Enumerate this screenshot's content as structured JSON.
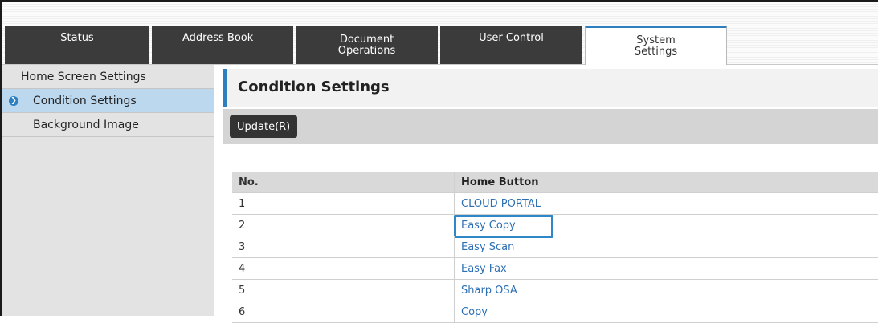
{
  "tabs": [
    {
      "label": "Status"
    },
    {
      "label": "Address Book"
    },
    {
      "label": "Document\nOperations"
    },
    {
      "label": "User Control"
    },
    {
      "label": "System\nSettings"
    }
  ],
  "sidebar": {
    "items": [
      {
        "label": "Home Screen Settings"
      },
      {
        "label": "Condition Settings"
      },
      {
        "label": "Background Image"
      }
    ],
    "selected_index": 1
  },
  "main": {
    "title": "Condition Settings",
    "update_label": "Update(R)"
  },
  "table": {
    "headers": [
      "No.",
      "Home Button"
    ],
    "rows": [
      [
        "1",
        "CLOUD PORTAL"
      ],
      [
        "2",
        "Easy Copy"
      ],
      [
        "3",
        "Easy Scan"
      ],
      [
        "4",
        "Easy Fax"
      ],
      [
        "5",
        "Sharp OSA"
      ],
      [
        "6",
        "Copy"
      ]
    ],
    "highlighted_row": 2
  },
  "colors": {
    "accent": "#2e7fc0",
    "tab_dark": "#3b3b3b",
    "link": "#2c6fb3",
    "selected_bg": "#bcd8ee"
  }
}
